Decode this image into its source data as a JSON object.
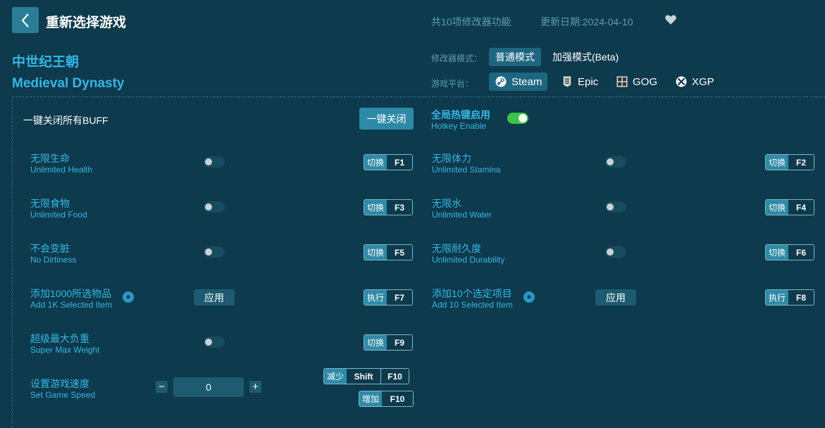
{
  "header": {
    "title": "重新选择游戏",
    "feature_count": "共10项修改器功能",
    "update_date": "更新日期:2024-04-10"
  },
  "game": {
    "name_cn": "中世纪王朝",
    "name_en": "Medieval Dynasty"
  },
  "mode": {
    "label": "修改器模式：",
    "options": [
      "普通模式",
      "加强模式(Beta)"
    ],
    "selected": "普通模式"
  },
  "platform": {
    "label": "游戏平台：",
    "options": [
      "Steam",
      "Epic",
      "GOG",
      "XGP"
    ],
    "selected": "Steam"
  },
  "global": {
    "oneclick_label": "一键关闭所有BUFF",
    "oneclick_button": "一键关闭",
    "hotkey_cn": "全局热键启用",
    "hotkey_en": "Hotkey Enable",
    "hotkey_enabled": true
  },
  "cheats": [
    {
      "cn": "无限生命",
      "en": "Unlimited Health",
      "action": "切换",
      "key": "F1",
      "on": false
    },
    {
      "cn": "无限体力",
      "en": "Unlimited Stamina",
      "action": "切换",
      "key": "F2",
      "on": false
    },
    {
      "cn": "无限食物",
      "en": "Unlimited Food",
      "action": "切换",
      "key": "F3",
      "on": false
    },
    {
      "cn": "无限水",
      "en": "Unlimited Water",
      "action": "切换",
      "key": "F4",
      "on": false
    },
    {
      "cn": "不会变脏",
      "en": "No Dirtiness",
      "action": "切换",
      "key": "F5",
      "on": false
    },
    {
      "cn": "无限耐久度",
      "en": "Unlimited Durability",
      "action": "切换",
      "key": "F6",
      "on": false
    },
    {
      "cn": "添加1000所选物品",
      "en": "Add 1K Selected Item",
      "action": "执行",
      "key": "F7",
      "apply": "应用"
    },
    {
      "cn": "添加10个选定项目",
      "en": "Add 10 Selected Item",
      "action": "执行",
      "key": "F8",
      "apply": "应用"
    },
    {
      "cn": "超级最大负重",
      "en": "Super Max Weight",
      "action": "切换",
      "key": "F9",
      "on": false
    }
  ],
  "speed": {
    "cn": "设置游戏速度",
    "en": "Set Game Speed",
    "value": "0",
    "minus": "−",
    "plus": "+",
    "decrease": {
      "action": "减少",
      "mod": "Shift",
      "key": "F10"
    },
    "increase": {
      "action": "增加",
      "key": "F10"
    }
  },
  "colors": {
    "background": "#0d3a4c",
    "accent": "#36b6e6",
    "toggle_on": "#3cc14a",
    "button": "#2d8aa6"
  }
}
